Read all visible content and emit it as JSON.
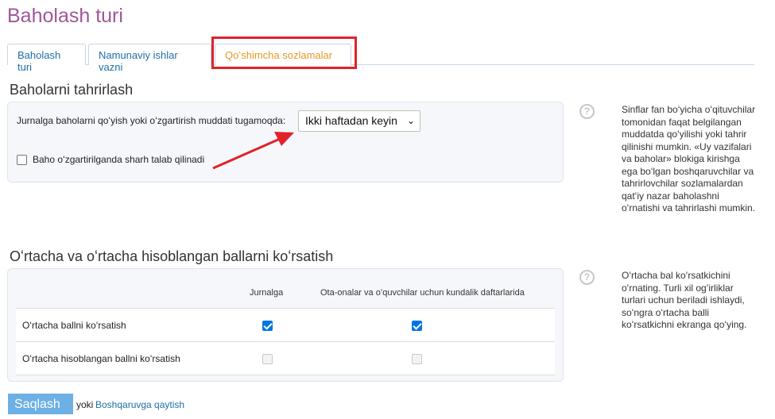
{
  "page": {
    "title": "Baholash turi"
  },
  "tabs": [
    {
      "label": "Baholash turi"
    },
    {
      "label": "Namunaviy ishlar vazni"
    },
    {
      "label": "Qoʻshimcha sozlamalar",
      "active": true
    }
  ],
  "section1": {
    "title": "Baholarni tahrirlash",
    "deadline_label": "Jurnalga baholarni qoʻyish yoki oʻzgartirish muddati tugamoqda:",
    "deadline_value": "Ikki haftadan keyin",
    "comment_label": "Baho oʻzgartirilganda sharh talab qilinadi",
    "comment_checked": false,
    "help_text": "Sinflar fan boʻyicha oʻqituvchilar tomonidan faqat belgilangan muddatda qoʻyilishi yoki tahrir qilinishi mumkin. «Uy vazifalari va baholar» blokiga kirishga ega boʻlgan boshqaruvchilar va tahrirlovchilar sozlamalardan qatʻiy nazar baholashni oʻrnatishi va tahrirlashi mumkin."
  },
  "section2": {
    "title": "Oʻrtacha va oʻrtacha hisoblangan ballarni koʻrsatish",
    "col_journal": "Jurnalga",
    "col_diary": "Ota-onalar va oʻquvchilar uchun kundalik daftarlarida",
    "rows": [
      {
        "label": "Oʻrtacha ballni koʻrsatish",
        "journal": true,
        "diary": true,
        "disabled": false
      },
      {
        "label": "Oʻrtacha hisoblangan ballni koʻrsatish",
        "journal": false,
        "diary": false,
        "disabled": true
      }
    ],
    "help_text": "Oʻrtacha bal koʻrsatkichini oʻrnating. Turli xil ogʻirliklar turlari uchun beriladi ishlaydi, soʻngra oʻrtacha balli koʻrsatkichni ekranga qoʻying."
  },
  "footer": {
    "save_label": "Saqlash",
    "or_label": "yoki",
    "back_label": "Boshqaruvga qaytish"
  },
  "colors": {
    "title": "#a0569c",
    "active_tab": "#e39a26",
    "link": "#1f6fa8",
    "highlight": "#e0222a",
    "save_button": "#6cb0e6"
  }
}
